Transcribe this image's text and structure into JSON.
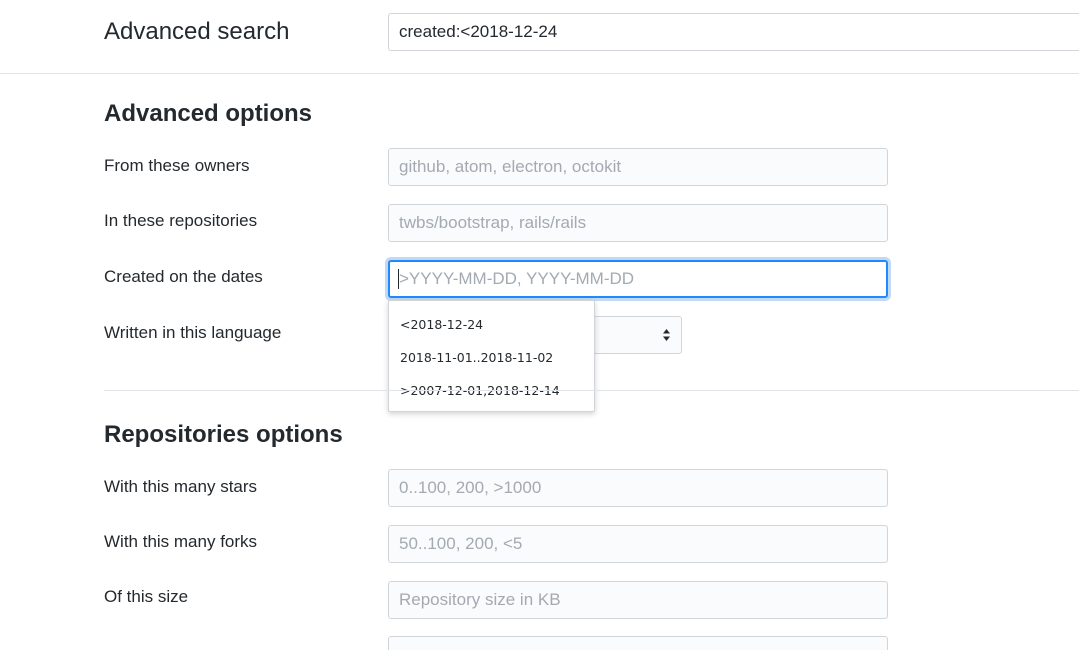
{
  "header": {
    "title": "Advanced search",
    "query_value": "created:<2018-12-24"
  },
  "advanced_options": {
    "title": "Advanced options",
    "fields": [
      {
        "label": "From these owners",
        "placeholder": "github, atom, electron, octokit"
      },
      {
        "label": "In these repositories",
        "placeholder": "twbs/bootstrap, rails/rails"
      },
      {
        "label": "Created on the dates",
        "placeholder": ">YYYY-MM-DD, YYYY-MM-DD"
      }
    ],
    "language_label": "Written in this language"
  },
  "autocomplete": {
    "items": [
      "<2018-12-24",
      "2018-11-01..2018-11-02",
      ">2007-12-01,2018-12-14"
    ]
  },
  "repositories_options": {
    "title": "Repositories options",
    "fields": [
      {
        "label": "With this many stars",
        "placeholder": "0..100, 200, >1000"
      },
      {
        "label": "With this many forks",
        "placeholder": "50..100, 200, <5"
      },
      {
        "label": "Of this size",
        "placeholder": "Repository size in KB"
      }
    ]
  },
  "colors": {
    "focus_border": "#2188ff",
    "text": "#24292e",
    "placeholder": "#a3aab1",
    "input_border": "#d1d5da"
  }
}
